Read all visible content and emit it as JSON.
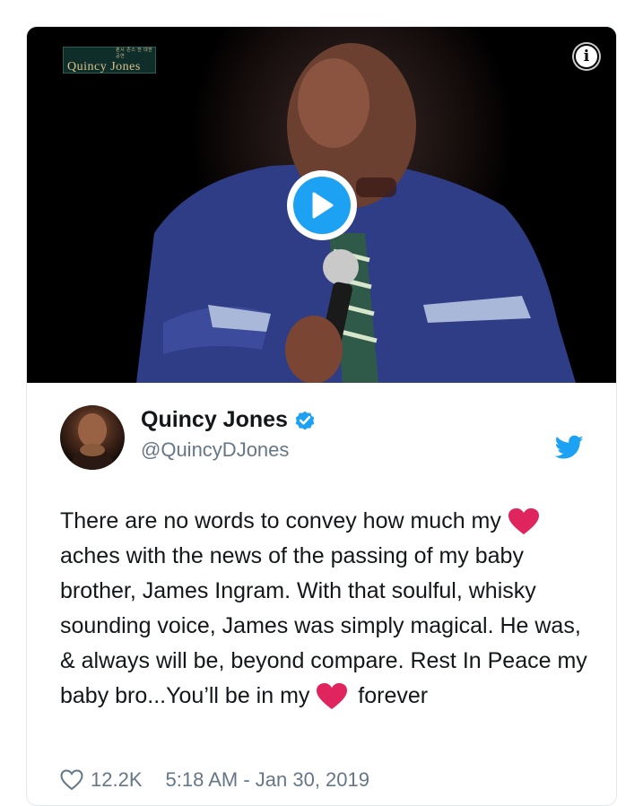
{
  "media": {
    "logo_small_text": "퀸시 존스 전 대한공연",
    "logo_text": "Quincy Jones",
    "info_label": "i"
  },
  "tweet": {
    "display_name": "Quincy Jones",
    "handle": "@QuincyDJones",
    "text_parts": [
      "There are no words to convey how much my ",
      " aches with the news of the passing of my baby brother, James Ingram. With that soulful, whisky sounding voice, James was simply magical. He was, & always will be, beyond compare. Rest In Peace my baby bro...You’ll be in my ",
      " forever"
    ],
    "likes": "12.2K",
    "timestamp": "5:18 AM - Jan 30, 2019"
  },
  "colors": {
    "twitter_blue": "#1da1f2",
    "heart_red": "#e0245e",
    "secondary_text": "#657786"
  },
  "icons": [
    "info-icon",
    "play-icon",
    "verified-badge-icon",
    "twitter-bird-icon",
    "heart-emoji-icon",
    "like-heart-icon"
  ]
}
